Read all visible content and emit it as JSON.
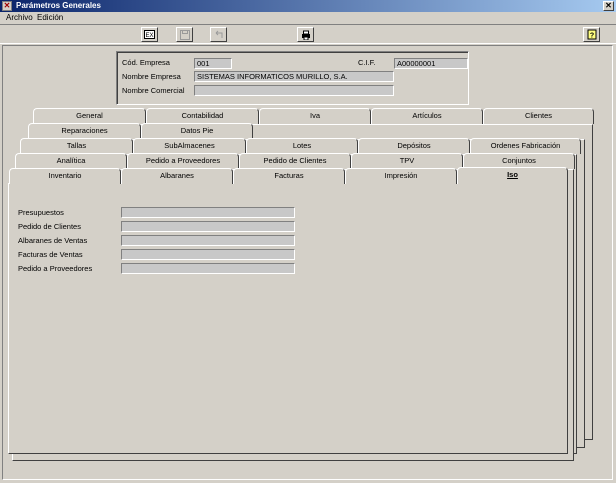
{
  "window": {
    "title": "Parámetros Generales"
  },
  "menu": {
    "items": [
      "Archivo",
      "Edición"
    ]
  },
  "header": {
    "cod_empresa_label": "Cód. Empresa",
    "cod_empresa_value": "001",
    "cif_label": "C.I.F.",
    "cif_value": "A00000001",
    "nombre_empresa_label": "Nombre Empresa",
    "nombre_empresa_value": "SISTEMAS INFORMATICOS MURILLO, S.A.",
    "nombre_comercial_label": "Nombre Comercial",
    "nombre_comercial_value": ""
  },
  "tabs": {
    "row1": [
      "General",
      "Contabilidad",
      "Iva",
      "Artículos",
      "Clientes"
    ],
    "row2": [
      "Reparaciones",
      "Datos Pie"
    ],
    "row3": [
      "Tallas",
      "SubAlmacenes",
      "Lotes",
      "Depósitos",
      "Ordenes Fabricación"
    ],
    "row4": [
      "Analítica",
      "Pedido a Proveedores",
      "Pedido de Clientes",
      "TPV",
      "Conjuntos"
    ],
    "row5": [
      "Inventario",
      "Albaranes",
      "Facturas",
      "Impresión",
      "Iso"
    ]
  },
  "iso": {
    "fields": [
      {
        "label": "Presupuestos",
        "value": ""
      },
      {
        "label": "Pedido de Clientes",
        "value": ""
      },
      {
        "label": "Albaranes de Ventas",
        "value": ""
      },
      {
        "label": "Facturas de Ventas",
        "value": ""
      },
      {
        "label": "Pedido a Proveedores",
        "value": ""
      }
    ]
  },
  "toolbar": {
    "icons": [
      "exit-icon",
      "save-icon",
      "undo-icon",
      "print-icon",
      "help-icon"
    ]
  }
}
